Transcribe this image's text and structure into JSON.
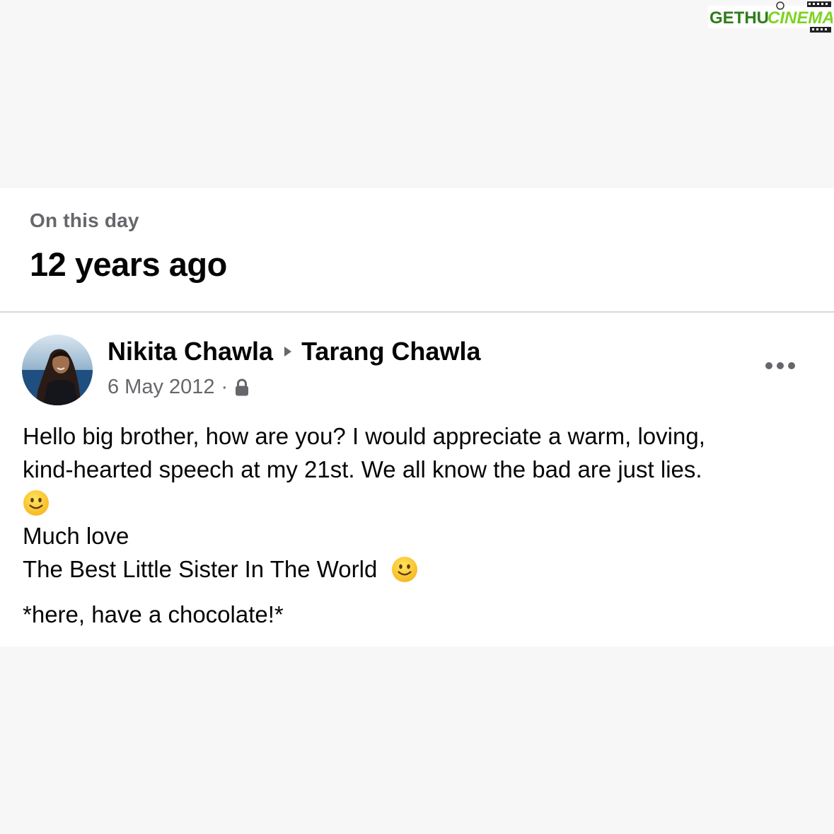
{
  "watermark": {
    "text_part1": "GETHU",
    "text_part2": "CINEMA",
    "color_part1": "#2e7d1a",
    "color_part2": "#7ed321"
  },
  "memory_header": {
    "subtitle": "On this day",
    "title": "12 years ago"
  },
  "post": {
    "author": "Nikita Chawla",
    "recipient": "Tarang Chawla",
    "date": "6 May 2012",
    "separator": "·",
    "privacy_icon": "lock-icon",
    "more_icon": "more-horizontal-icon",
    "body_line1": "Hello big brother, how are you? I would appreciate a warm, loving,",
    "body_line2": "kind-hearted speech at my 21st. We all know the bad are just lies.",
    "body_line3": "Much love",
    "body_line4": "The Best Little Sister In The World",
    "body_footer": "*here, have a chocolate!*",
    "emoji": "slightly-smiling-face-icon"
  },
  "colors": {
    "background": "#f7f7f7",
    "card": "#ffffff",
    "primary_text": "#050505",
    "secondary_text": "#65676b",
    "divider": "#d6d8dc"
  }
}
